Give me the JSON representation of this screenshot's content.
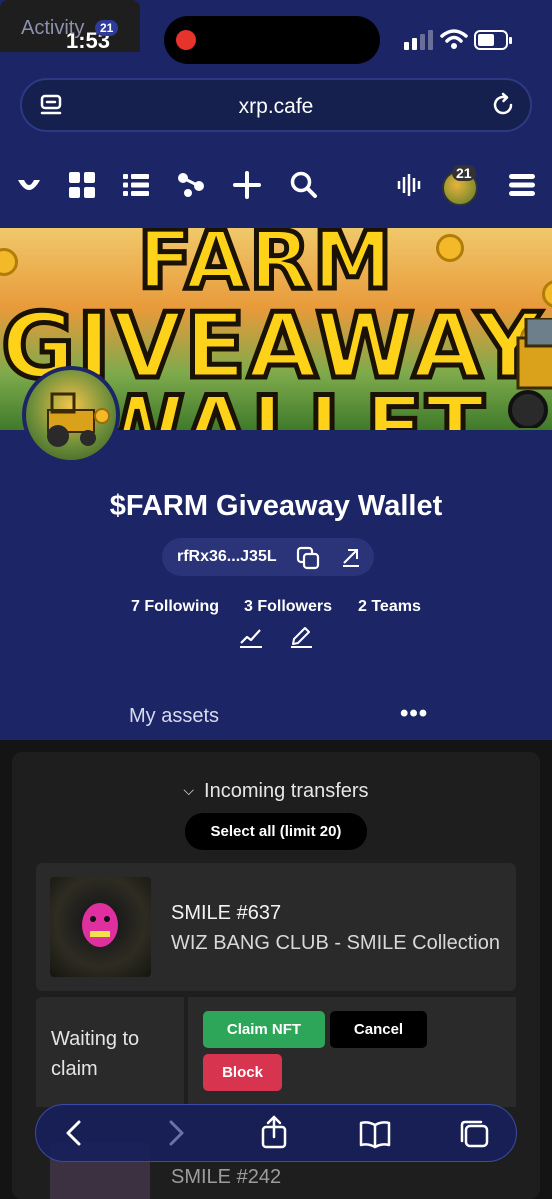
{
  "status": {
    "time": "1:53"
  },
  "browser": {
    "url": "xrp.cafe"
  },
  "nav": {
    "notification_count": "21"
  },
  "profile": {
    "wallet_name": "$FARM Giveaway Wallet",
    "address": "rfRx36...J35L",
    "stats": {
      "following": "7 Following",
      "followers": "3 Followers",
      "teams": "2 Teams"
    }
  },
  "banner": {
    "line1": "FARM",
    "line2": "GIVEAWAY",
    "line3": "WALLET"
  },
  "tabs": {
    "assets": "My assets",
    "activity": "Activity",
    "activity_count": "21",
    "more": "•••"
  },
  "incoming": {
    "header": "Incoming transfers",
    "select_all": "Select all (limit 20)",
    "items": [
      {
        "title": "SMILE #637",
        "collection": "WIZ BANG CLUB - SMILE Collection",
        "status": "Waiting to claim",
        "actions": {
          "claim": "Claim NFT",
          "cancel": "Cancel",
          "block": "Block"
        }
      },
      {
        "title": "SMILE #242"
      }
    ]
  },
  "colors": {
    "brand_blue": "#1c2566",
    "claim_green": "#2ea65a",
    "block_red": "#d7354f"
  }
}
